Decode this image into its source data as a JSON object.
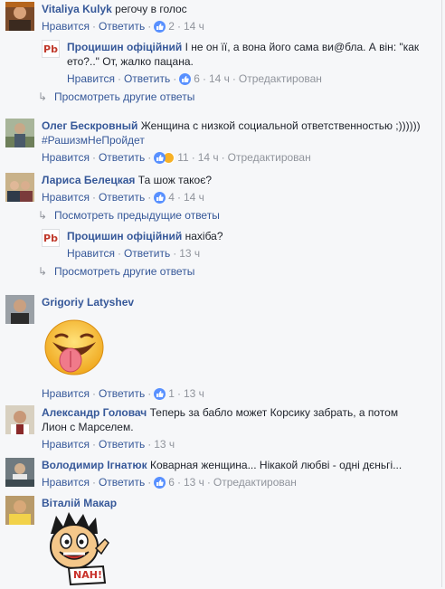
{
  "actions": {
    "like": "Нравится",
    "reply": "Ответить",
    "sep": "·"
  },
  "comments": [
    {
      "author": "Vitaliya Kulyk",
      "text": "регочу в голос",
      "likes": "2",
      "time": "14 ч",
      "reply": {
        "author": "Процишин офіційний",
        "text": "І не он її, а вона його сама ви@бла. А він: \"как ето?..\" От, жалко пацана.",
        "likes": "6",
        "time": "14 ч",
        "edited": "Отредактирован"
      },
      "more": "Просмотреть другие ответы"
    },
    {
      "author": "Олег Бескровный",
      "text": "Женщина с низкой социальной ответственностью ;))))))",
      "hashtag": "#РашизмНеПройдет",
      "likes": "11",
      "time": "14 ч",
      "edited": "Отредактирован"
    },
    {
      "author": "Лариса Белецкая",
      "text": "Та шож такоє?",
      "likes": "4",
      "time": "14 ч",
      "prev": "Посмотреть предыдущие ответы",
      "reply": {
        "author": "Процишин офіційний",
        "text": "нахіба?",
        "time": "13 ч"
      },
      "more": "Просмотреть другие ответы"
    },
    {
      "author": "Grigoriy Latyshev",
      "likes": "1",
      "time": "13 ч"
    },
    {
      "author": "Александр Головач",
      "text": "Теперь за бабло может Корсику забрать, а потом Лион с Марселем.",
      "time": "13 ч"
    },
    {
      "author": "Володимир Ігнатюк",
      "text": "Коварная женщина... Нікакой любві - одні дєньгі...",
      "likes": "6",
      "time": "13 ч",
      "edited": "Отредактирован"
    },
    {
      "author": "Віталій Макар",
      "sticker_text": "NAH!"
    }
  ],
  "pb_logo": "Pb",
  "colors": {
    "link": "#365899",
    "meta": "#90949c",
    "text": "#1d2129",
    "bg": "#f6f7f9",
    "like_blue": "#5890ff",
    "haha_yellow": "#f7b125"
  },
  "icons": [
    "like-reaction-icon",
    "haha-reaction-icon",
    "reply-arrow-icon",
    "tongue-emoji-sticker",
    "nah-cartoon-sticker"
  ]
}
